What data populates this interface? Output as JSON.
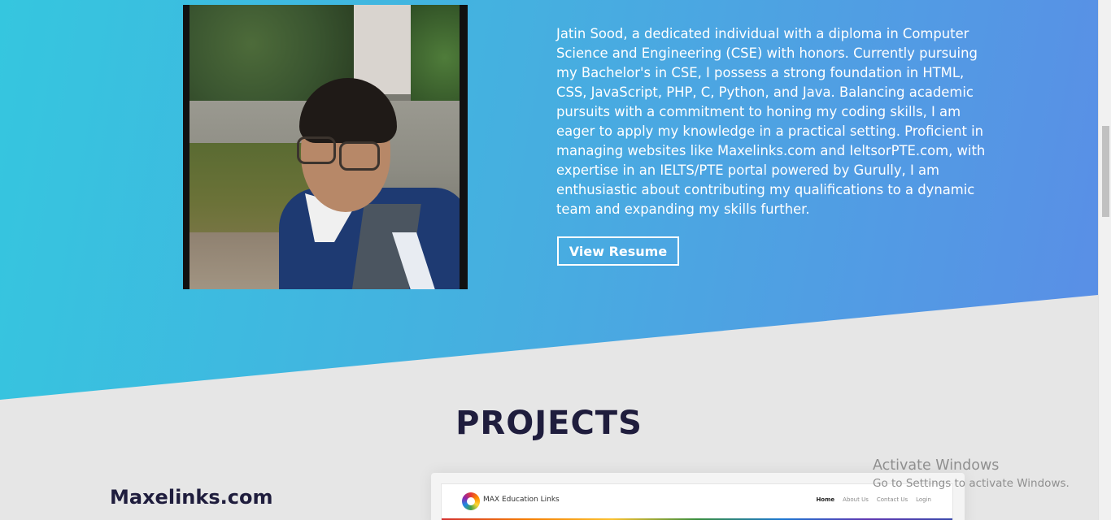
{
  "about": {
    "bio": "Jatin Sood, a dedicated individual with a diploma in Computer Science and Engineering (CSE) with honors. Currently pursuing my Bachelor's in CSE, I possess a strong foundation in HTML, CSS, JavaScript, PHP, C, Python, and Java. Balancing academic pursuits with a commitment to honing my coding skills, I am eager to apply my knowledge in a practical setting. Proficient in managing websites like Maxelinks.com and IeltsorPTE.com, with expertise in an IELTS/PTE portal powered by Gurully, I am enthusiastic about contributing my qualifications to a dynamic team and expanding my skills further.",
    "resume_button": "View Resume"
  },
  "projects": {
    "heading": "PROJECTS",
    "items": [
      {
        "name": "Maxelinks.com",
        "preview": {
          "brand": "MAX Education Links",
          "nav": [
            "Home",
            "About Us",
            "Contact Us",
            "Login"
          ]
        }
      }
    ]
  },
  "watermark": {
    "title": "Activate Windows",
    "subtitle": "Go to Settings to activate Windows."
  },
  "theme": {
    "gradient_start": "#35c6df",
    "gradient_end": "#5a8ee6",
    "heading_color": "#1f1d3d",
    "page_bg": "#e6e6e6"
  }
}
